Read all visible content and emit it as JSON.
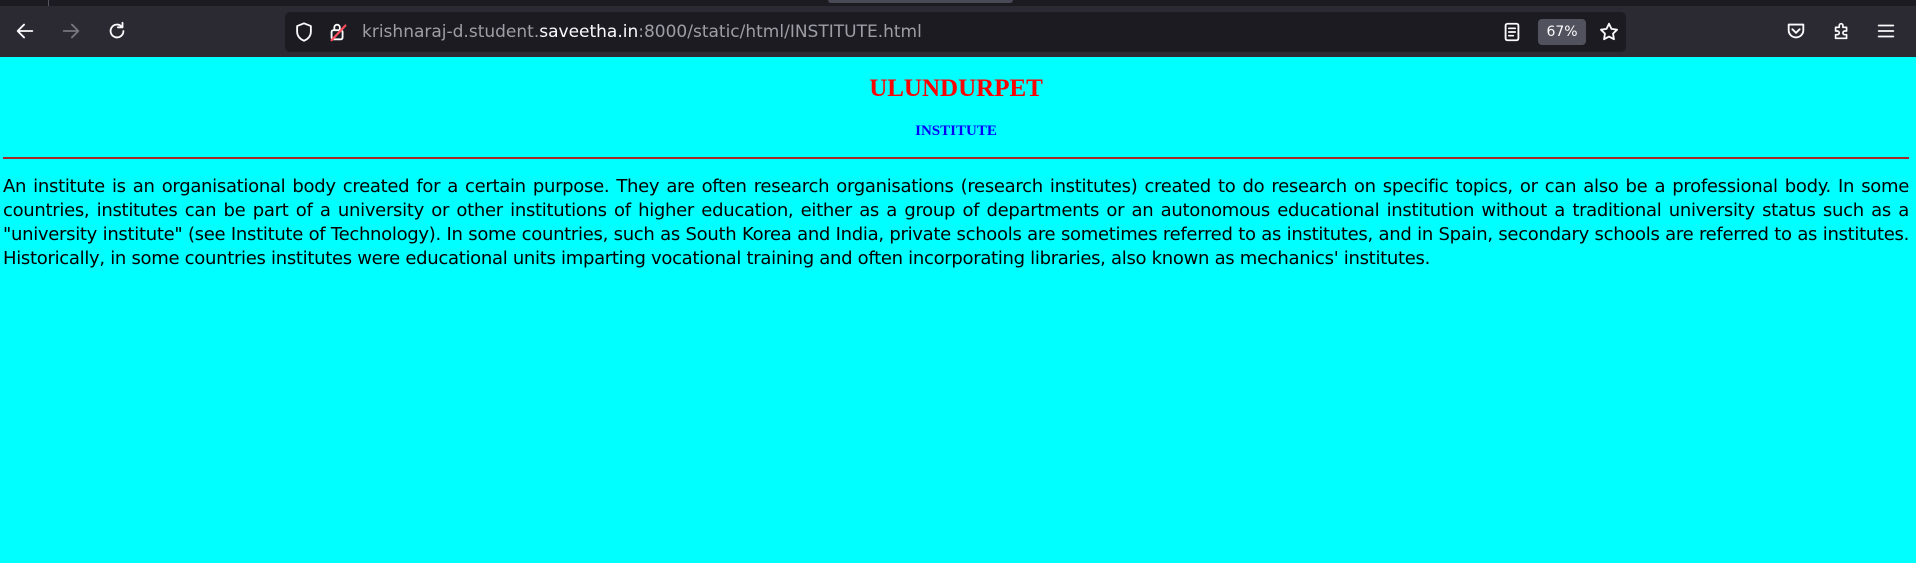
{
  "browser": {
    "url_prefix": "krishnaraj-d.student.",
    "url_host": "saveetha.in",
    "url_suffix": ":8000/static/html/INSTITUTE.html",
    "zoom": "67%",
    "icons": {
      "back": "arrow-left-icon",
      "forward": "arrow-right-icon",
      "reload": "reload-icon",
      "tracking": "shield-icon",
      "connection": "lock-warning-icon",
      "reader": "reader-view-icon",
      "bookmark": "star-icon",
      "pocket": "pocket-icon",
      "extensions": "puzzle-icon",
      "menu": "hamburger-menu-icon"
    },
    "colors": {
      "chrome_bg": "#2b2a33",
      "urlbar_bg": "#1c1b22",
      "text_dim": "#9e9ea6",
      "text_bright": "#fbfbfe"
    }
  },
  "page": {
    "title": "ULUNDURPET",
    "subtitle": "INSTITUTE",
    "body": "An institute is an organisational body created for a certain purpose. They are often research organisations (research institutes) created to do research on specific topics, or can also be a professional body. In some countries, institutes can be part of a university or other institutions of higher education, either as a group of departments or an autonomous educational institution without a traditional university status such as a \"university institute\" (see Institute of Technology). In some countries, such as South Korea and India, private schools are sometimes referred to as institutes, and in Spain, secondary schools are referred to as institutes. Historically, in some countries institutes were educational units imparting vocational training and often incorporating libraries, also known as mechanics' institutes.",
    "colors": {
      "background": "#00ffff",
      "title": "#ff0000",
      "subtitle": "#0000ff",
      "rule": "#a52a2a",
      "body_text": "#000000"
    }
  }
}
